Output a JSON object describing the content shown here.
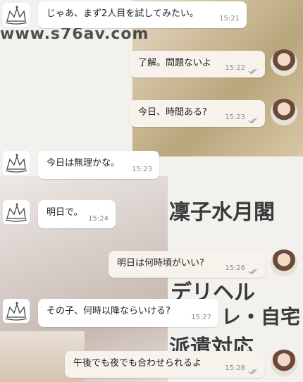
{
  "watermark": "www.s76av.com",
  "ad": {
    "line1": "凜子水月閣",
    "line2": "デリヘル",
    "line3": "レ・自宅",
    "line4": "派遣対応"
  },
  "messages": [
    {
      "dir": "in",
      "text": "じゃあ、まず2人目を試してみたい。",
      "time": "15:21"
    },
    {
      "dir": "out",
      "text": "了解。問題ないよ",
      "time": "15:22",
      "read": true
    },
    {
      "dir": "out",
      "text": "今日、時間ある?",
      "time": "15:23",
      "read": true
    },
    {
      "dir": "in",
      "text": "今日は無理かな。",
      "time": "15:23"
    },
    {
      "dir": "in",
      "text": "明日で。",
      "time": "15:24"
    },
    {
      "dir": "out",
      "text": "明日は何時頃がいい?",
      "time": "15:26",
      "read": true
    },
    {
      "dir": "in",
      "text": "その子、何時以降ならいける?",
      "time": "15:27"
    },
    {
      "dir": "out",
      "text": "午後でも夜でも合わせられるよ",
      "time": "15:28",
      "read": true
    }
  ],
  "icons": {
    "incoming_avatar": "sketch-crown-avatar-icon",
    "outgoing_avatar": "profile-photo-avatar",
    "read_receipt": "double-check-icon"
  },
  "colors": {
    "bubble_in": "#ffffff",
    "bubble_out": "#f7f3ec",
    "time_text": "#8a8a8a",
    "tick": "#9aa0a6"
  }
}
